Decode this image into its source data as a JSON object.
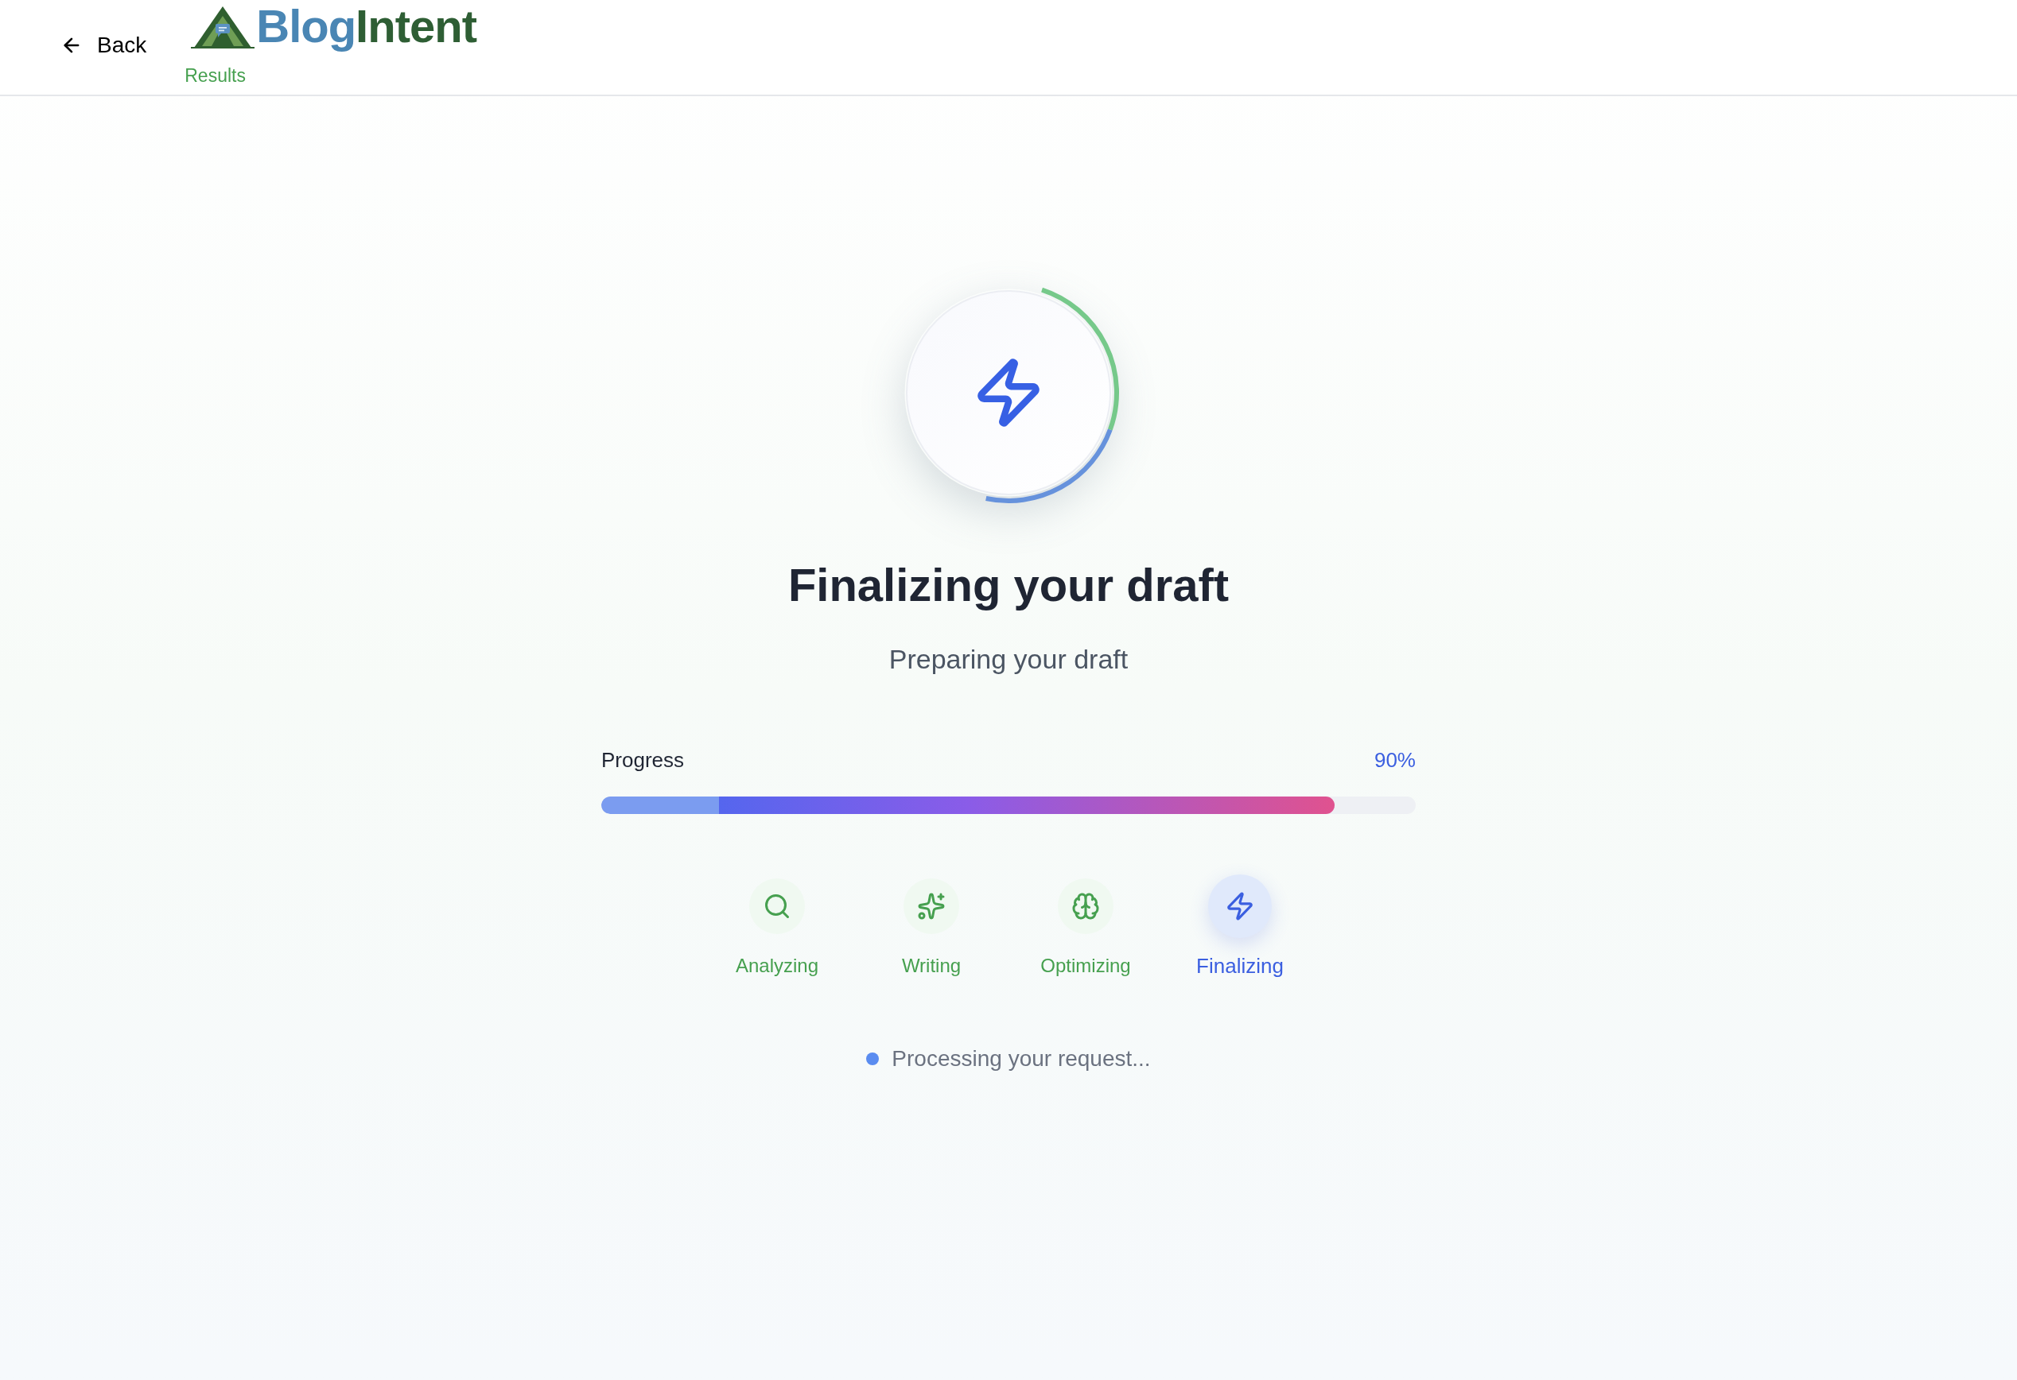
{
  "header": {
    "back": "Back",
    "logo_words": [
      {
        "text": "Blog",
        "color": "#4a86b4"
      },
      {
        "text": "Intent",
        "color": "#2e5e34"
      }
    ],
    "subtitle": "Results"
  },
  "title": "Finalizing your draft",
  "subtitle": "Preparing your draft",
  "progress": {
    "label": "Progress",
    "reading": "90%",
    "level": 0.9
  },
  "steps": [
    {
      "label": "Analyzing",
      "kind": "search",
      "completed": true,
      "selected": false
    },
    {
      "label": "Writing",
      "kind": "sparkles",
      "completed": true,
      "selected": false
    },
    {
      "label": "Optimizing",
      "kind": "brain",
      "completed": true,
      "selected": false
    },
    {
      "label": "Finalizing",
      "kind": "zap",
      "completed": false,
      "selected": true
    }
  ],
  "status": "Processing your request..."
}
